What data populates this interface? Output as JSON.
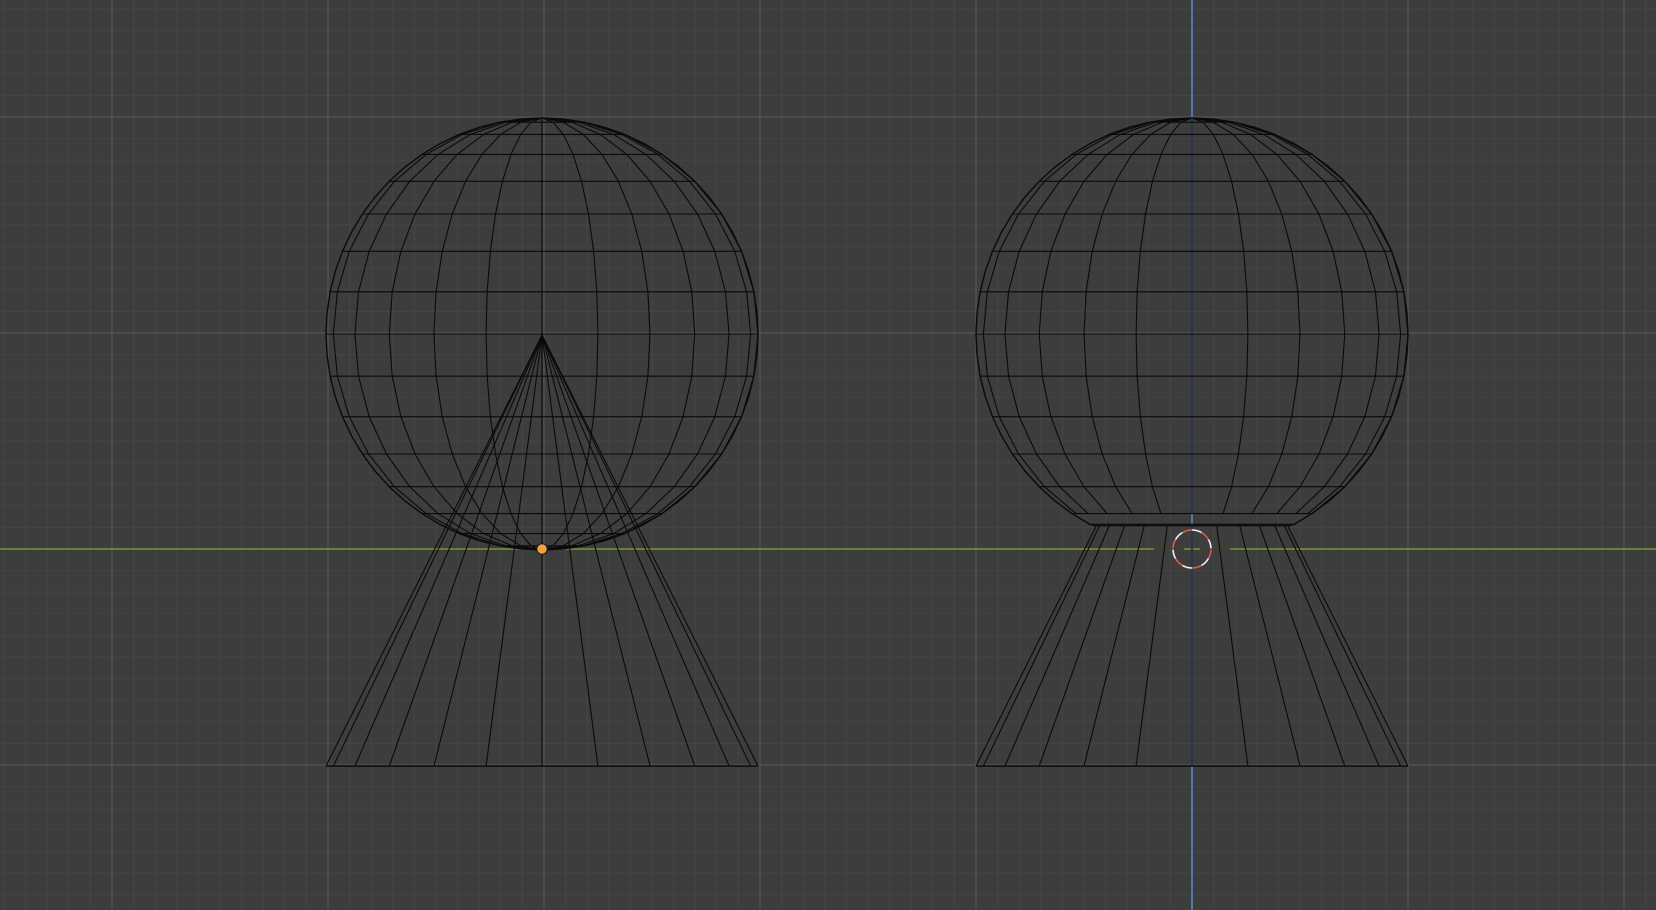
{
  "viewport": {
    "view": "front-orthographic",
    "mode": "wireframe",
    "grid": true
  },
  "colors": {
    "background": "#3d3d3d",
    "grid_minor": "#454545",
    "grid_major": "#525252",
    "x_axis": "#6f9632",
    "z_axis": "#4f86c6",
    "wire": "#0a0a0a",
    "origin_dot": "#f2a13b",
    "cursor_red": "#e05a4f",
    "cursor_white": "#f2f2f2"
  },
  "objects": [
    {
      "name": "sphere",
      "type": "uv-sphere",
      "segments": 24,
      "rings": 16,
      "selected": false
    },
    {
      "name": "cone",
      "type": "cone",
      "segments": 24,
      "selected": false
    },
    {
      "name": "sphere-cone-union",
      "type": "boolean-union",
      "selected": true
    }
  ],
  "icons": {
    "origin": "origin-point-icon",
    "cursor": "3d-cursor-icon"
  }
}
